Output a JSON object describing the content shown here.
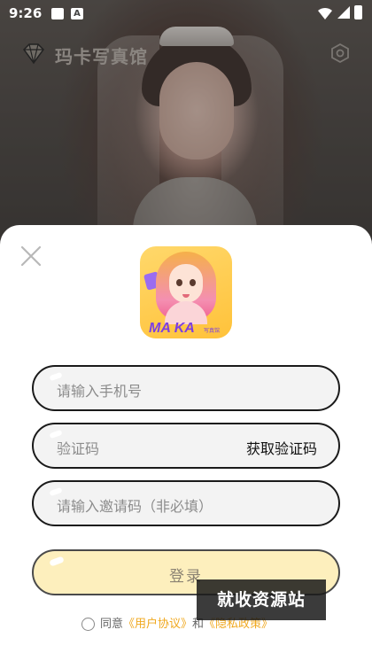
{
  "status_bar": {
    "time": "9:26",
    "a_icon_letter": "A"
  },
  "header": {
    "brand_name": "玛卡写真馆"
  },
  "login_sheet": {
    "app_icon": {
      "name": "MA KA",
      "sub": "写真馆"
    },
    "phone_placeholder": "请输入手机号",
    "code_placeholder": "验证码",
    "get_code_label": "获取验证码",
    "invite_placeholder": "请输入邀请码（非必填）",
    "login_label": "登录",
    "agreement": {
      "prefix": "同意",
      "user_agreement": "《用户协议》",
      "conjunction": "和",
      "privacy_policy": "《隐私政策》"
    }
  },
  "watermark": "就收资源站",
  "colors": {
    "accent_link": "#f0a81e",
    "login_bg": "#fdefbd",
    "field_bg": "#f3f3f3"
  }
}
